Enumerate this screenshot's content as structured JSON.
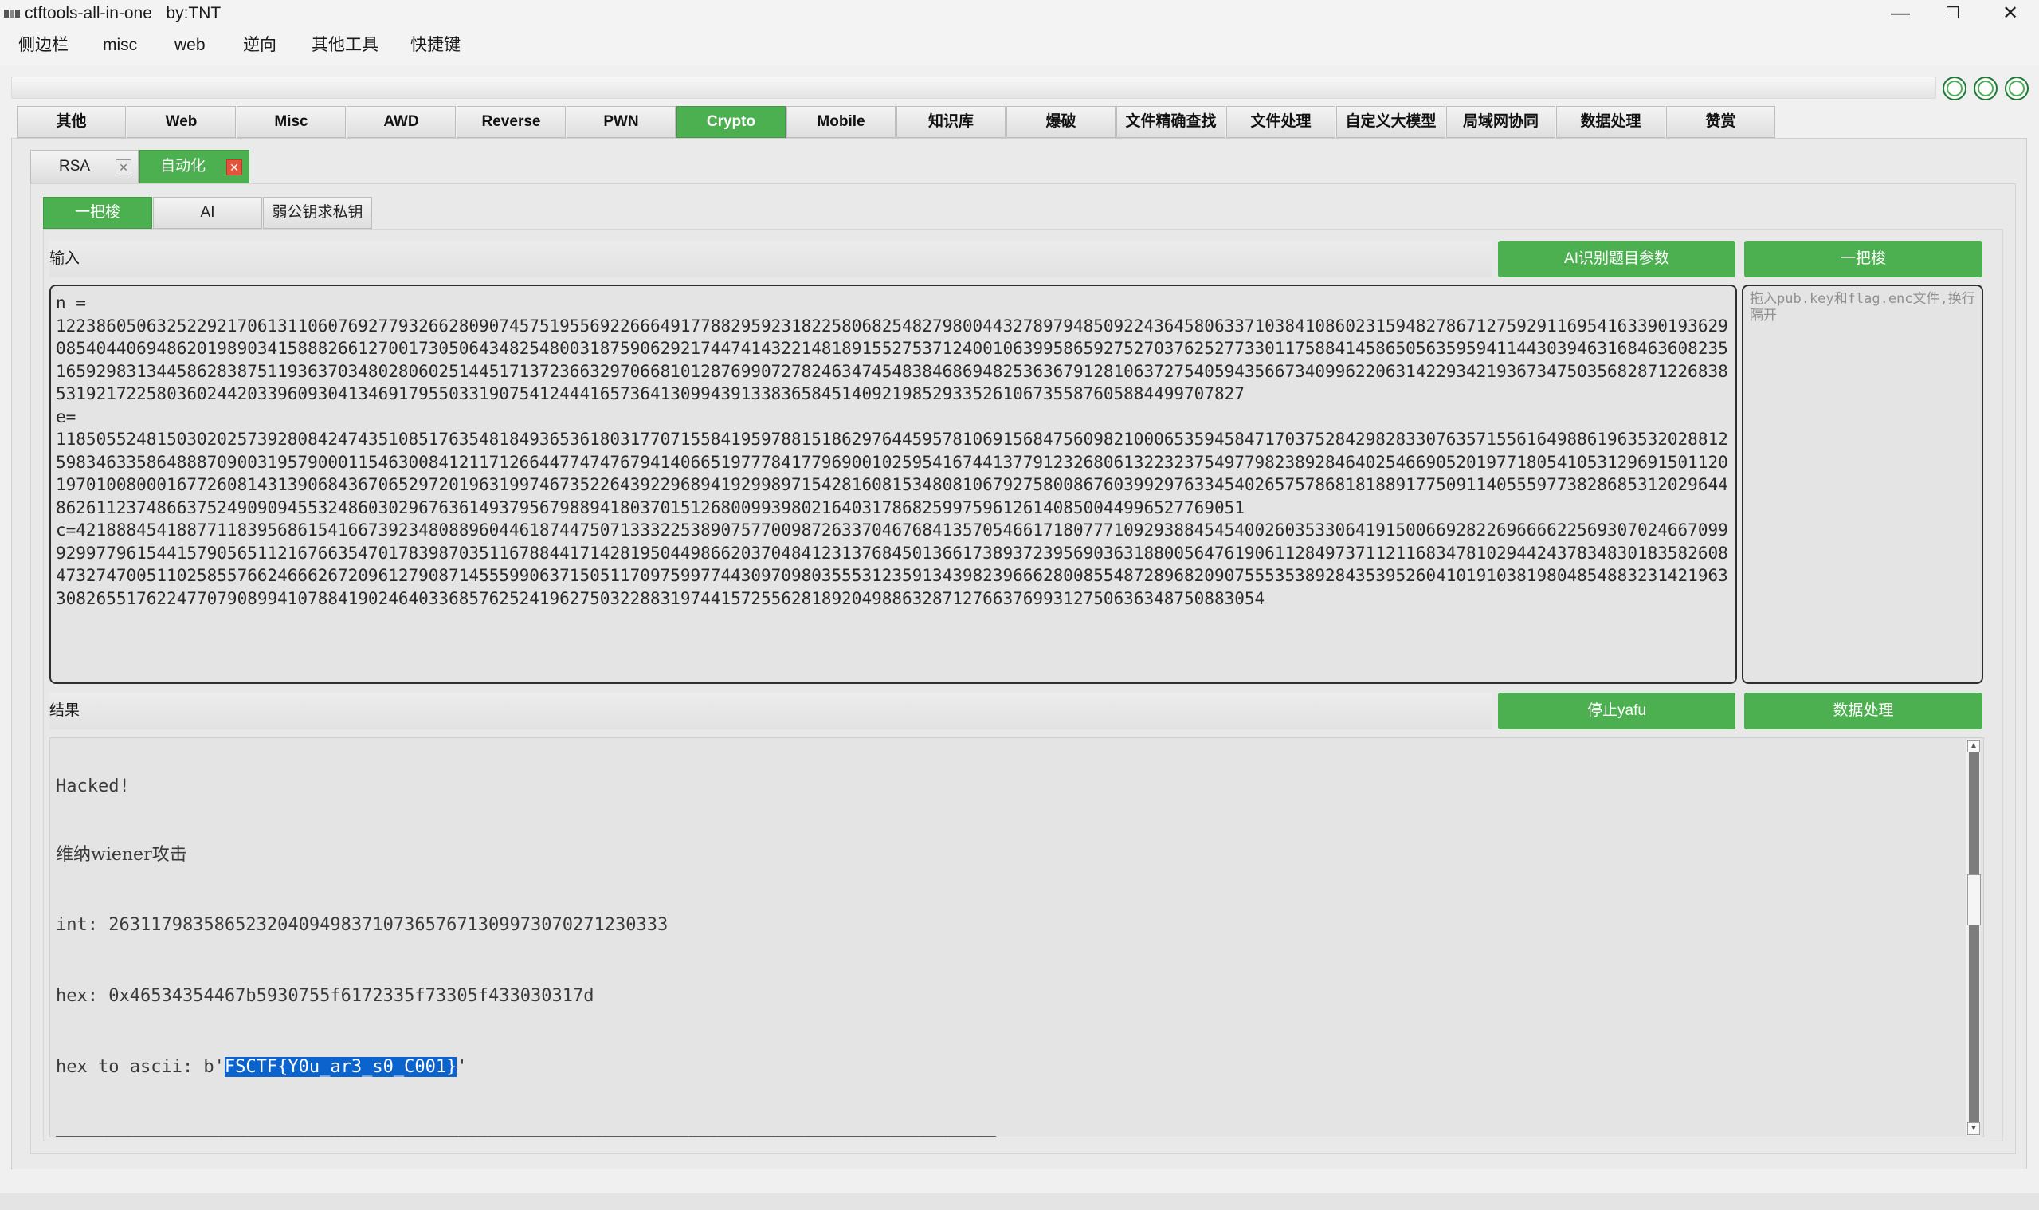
{
  "window": {
    "title": "ctftools-all-in-one   by:TNT",
    "minimize": "—",
    "maximize": "❐",
    "close": "✕"
  },
  "menu": [
    "侧边栏",
    "misc",
    "web",
    "逆向",
    "其他工具",
    "快捷键"
  ],
  "main_tabs": [
    "其他",
    "Web",
    "Misc",
    "AWD",
    "Reverse",
    "PWN",
    "Crypto",
    "Mobile",
    "知识库",
    "爆破",
    "文件精确查找",
    "文件处理",
    "自定义大模型",
    "局域网协同",
    "数据处理",
    "赞赏"
  ],
  "main_tab_active": "Crypto",
  "sub_tabs": [
    {
      "label": "RSA",
      "close": "✕"
    },
    {
      "label": "自动化",
      "close": "✕"
    }
  ],
  "inner_tabs": [
    "一把梭",
    "AI",
    "弱公钥求私钥"
  ],
  "input_section": {
    "label": "输入",
    "ai_button": "AI识别题目参数",
    "run_button": "一把梭",
    "text": "n = \n1223860506325229217061311060769277932662809074575195569226664917788295923182258068254827980044327897948509224364580633710384108602315948278671275929116954163390193629085404406948620198903415888266127001730506434825480031875906292174474143221481891552753712400106399586592752703762527733011758841458650563595941144303946316846360823516592983134458628387511936370348028060251445171372366329706681012876990727824634745483846869482536367912810637275405943566734099622063142293421936734750356828712268385319217225803602442033960930413469179550331907541244416573641309943913383658451409219852933526106735587605884499707827\ne=\n1185055248150302025739280842474351085176354818493653618031770715584195978815186297644595781069156847560982100065359458471703752842982833076357155616498861963532028812598346335864888709003195790001154630084121171266447747476794140665197778417796900102595416744137791232680613223237549779823892846402546690520197718054105312969150112019701008000167726081431390684367065297201963199746735226439229689419299897154281608153480810679275800867603992976334540265757868181889177509114055597738286853120296448626112374866375249090945532486030296763614937956798894180370151268009939802164031786825997596126140850044996527769051\nc=4218884541887711839568615416673923480889604461874475071333225389075770098726337046768413570546617180777109293884545400260353306419150066928226966662256930702466709992997796154415790565112167663547017839870351167884417142819504498662037048412313768450136617389372395690363188005647619061128497371121168347810294424378348301835826084732747005110258557662466626720961279087145559906371505117097599774430970980355531235913439823966628008554872896820907555353892843539526041019103819804854883231421963308265517622477079089941078841902464033685762524196275032288319744157255628189204988632871276637699312750636348750883054"
  },
  "drop_placeholder": "拖入pub.key和flag.enc文件,换行隔开",
  "result_section": {
    "label": "结果",
    "stop_button": "停止yafu",
    "data_button": "数据处理",
    "lines": {
      "hacked": "Hacked!",
      "wiener": "维纳wiener攻击",
      "int": "int: 26311798358652320409498371073657671309973070271230333",
      "hex": "hex: 0x46534354467b5930755f6172335f73305f433030317d",
      "ascii_prefix": "hex to ascii: b'",
      "ascii_flag": "FSCTF{Y0u_ar3_s0_C001}",
      "ascii_suffix": "'",
      "separator": "__________________________________________________________________________________________________"
    }
  },
  "scrollbar": {
    "up": "▲",
    "down": "▼"
  },
  "colors": {
    "accent_green": "#4caf50",
    "close_red": "#e5533d",
    "selection_blue": "#0b63ce"
  }
}
